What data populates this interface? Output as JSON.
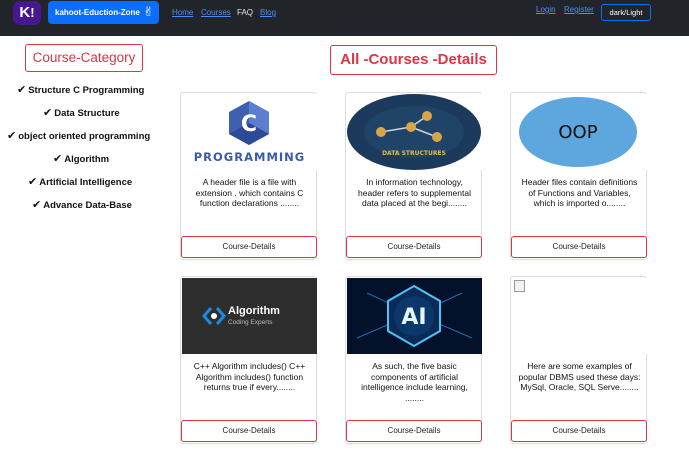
{
  "navbar": {
    "logo_text": "K",
    "logo_mark": "!",
    "brand_label": "kahoot-Eduction-Zone",
    "brand_icon": "victory-hand-icon",
    "links": {
      "home": "Home",
      "courses": "Courses",
      "faq": "FAQ",
      "blog": "Blog",
      "login": "Login",
      "register": "Register"
    },
    "theme_toggle": "dark/Light"
  },
  "sidebar": {
    "heading": "Course-Category",
    "check_icon": "✔",
    "items": [
      "Structure C Programming",
      "Data Structure",
      "object oriented programming",
      "Algorithm",
      "Artificial Intelligence",
      "Advance Data-Base"
    ]
  },
  "main": {
    "heading": "All -Courses -Details",
    "button_label": "Course-Details",
    "cards": [
      {
        "image": "c-programming-logo",
        "image_text": "PROGRAMMING",
        "image_letter": "C",
        "text": "A header file is a file with extension . which contains C function declarations ........"
      },
      {
        "image": "data-structures-graph",
        "image_text": "DATA STRUCTURES",
        "text": "In information technology, header refers to supplemental data placed at the begi........"
      },
      {
        "image": "oop-ellipse",
        "image_text": "OOP",
        "text": "Header files contain definitions of Functions and Variables, which is imported o........"
      },
      {
        "image": "algorithm-banner",
        "image_text": "Algorithm",
        "image_subtext": "Coding Experts",
        "text": "C++ Algorithm includes() C++ Algorithm includes() function returns true if every........"
      },
      {
        "image": "ai-chip",
        "image_text": "AI",
        "text": "As such, the five basic components of artificial intelligence include learning, ........"
      },
      {
        "image": "broken-image",
        "text": "Here are some examples of popular DBMS used these days: MySql, Oracle, SQL Serve........"
      }
    ]
  },
  "colors": {
    "navbar_bg": "#212529",
    "brand_blue": "#0d6efd",
    "accent_red": "#dc3545",
    "logo_purple": "#46178f"
  }
}
